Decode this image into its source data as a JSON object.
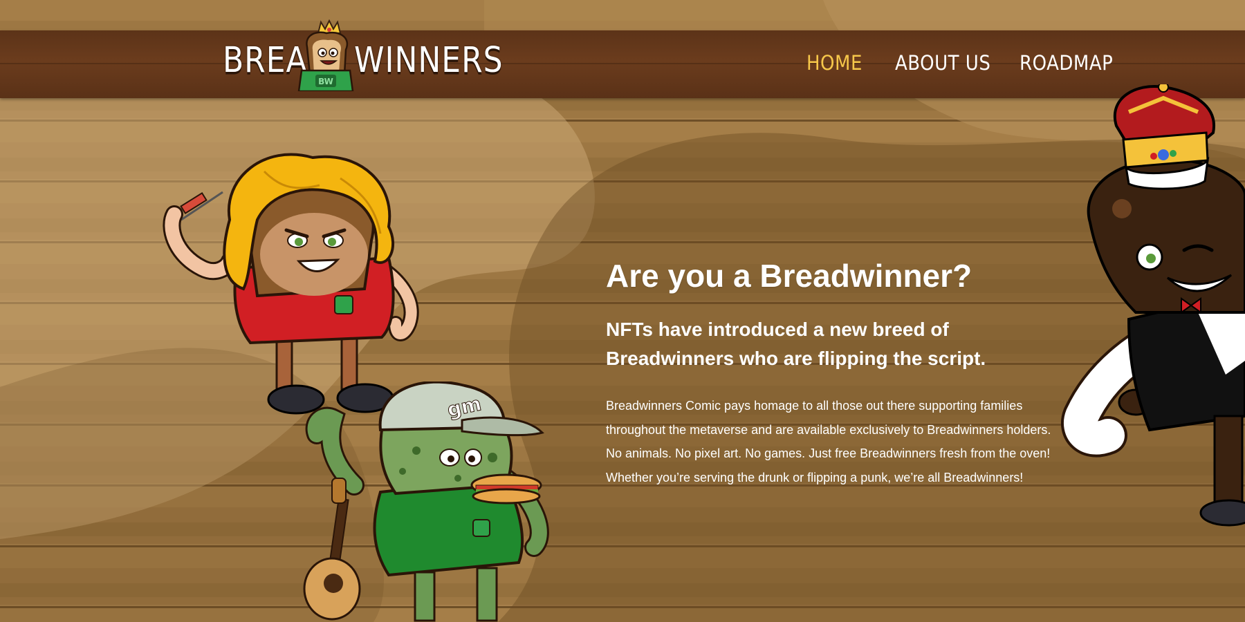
{
  "brand": {
    "word_left": "BREAD",
    "word_right": "WINNERS",
    "badge": "BW"
  },
  "nav": {
    "items": [
      {
        "label": "HOME",
        "active": true
      },
      {
        "label": "ABOUT US",
        "active": false
      },
      {
        "label": "ROADMAP",
        "active": false
      }
    ]
  },
  "hero": {
    "title": "Are you a Breadwinner?",
    "subtitle": "NFTs have introduced a new breed of Breadwinners who are flipping the script.",
    "body_lines": [
      "Breadwinners Comic pays homage to all those out there supporting families",
      "throughout the metaverse and are available exclusively to Breadwinners holders.",
      "No animals. No pixel art. No games. Just free Breadwinners fresh from the oven!",
      "Whether you’re serving the drunk or flipping a punk, we’re all Breadwinners!"
    ]
  },
  "characters": {
    "green_cap_text": "gm"
  },
  "colors": {
    "wood": "#9a7440",
    "navbar": "#5e3419",
    "nav_active": "#f6c74a",
    "text": "#ffffff"
  }
}
